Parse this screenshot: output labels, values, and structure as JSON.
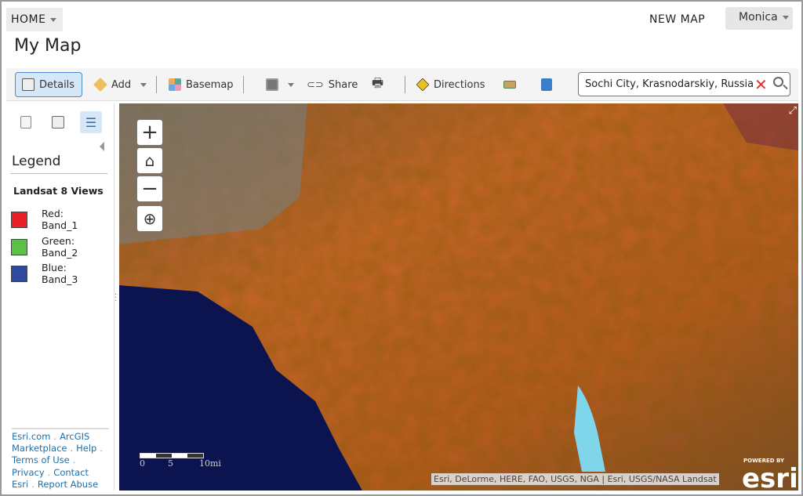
{
  "header": {
    "home": "HOME",
    "new_map": "NEW MAP",
    "user": "Monica",
    "title": "My Map"
  },
  "toolbar": {
    "details": "Details",
    "add": "Add",
    "basemap": "Basemap",
    "share": "Share",
    "directions": "Directions"
  },
  "search": {
    "value": "Sochi City, Krasnodarskiy, Russia"
  },
  "sidebar": {
    "legend_title": "Legend",
    "layer": "Landsat 8 Views",
    "items": [
      {
        "label1": "Red:",
        "label2": "Band_1",
        "color": "#e8202a"
      },
      {
        "label1": "Green:",
        "label2": "Band_2",
        "color": "#5cbf46"
      },
      {
        "label1": "Blue:",
        "label2": "Band_3",
        "color": "#2d4a9e"
      }
    ],
    "footer": [
      "Esri.com",
      "ArcGIS Marketplace",
      "Help",
      "Terms of Use",
      "Privacy",
      "Contact Esri",
      "Report Abuse"
    ]
  },
  "map": {
    "attribution": "Esri, DeLorme, HERE, FAO, USGS, NGA | Esri, USGS/NASA Landsat",
    "scale": [
      "0",
      "5",
      "10mi"
    ],
    "powered_by": "POWERED BY",
    "logo": "esri"
  }
}
